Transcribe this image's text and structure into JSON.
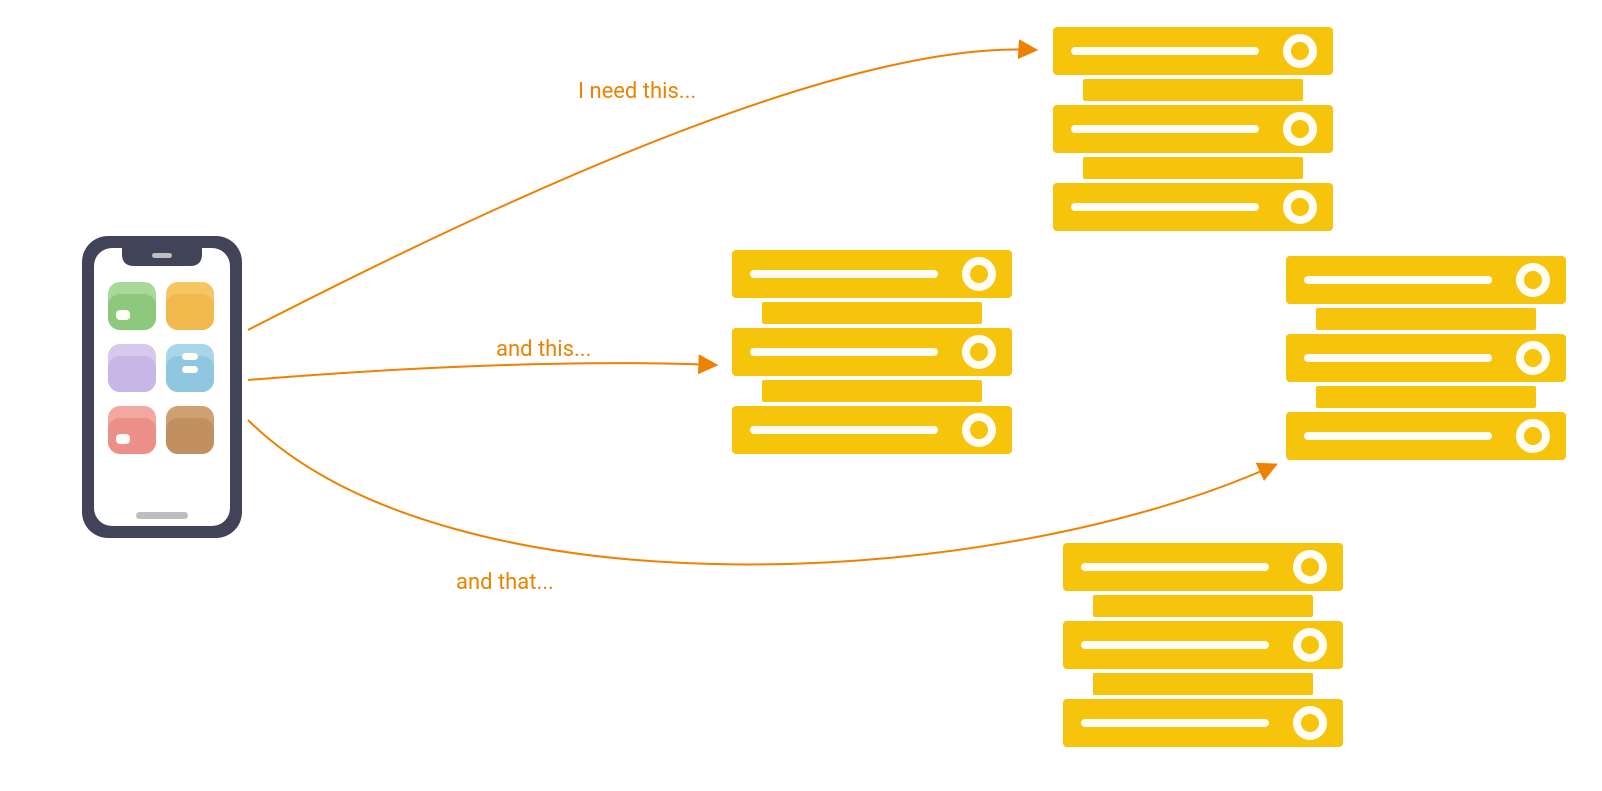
{
  "labels": {
    "arrow1": "I need this...",
    "arrow2": "and this...",
    "arrow3": "and that..."
  },
  "colors": {
    "server": "#F6C40A",
    "server_light": "#FFFDF6",
    "arrow": "#ED8200",
    "phone_frame": "#414358",
    "phone_screen": "#FFFFFF",
    "phone_speaker": "#BEBEBE",
    "phone_home": "#BEBEBE",
    "app_green_a": "#A9D89A",
    "app_green_b": "#8CC97D",
    "app_yellow_a": "#F5C662",
    "app_yellow_b": "#F1B94C",
    "app_purple_a": "#D7C9EE",
    "app_purple_b": "#C7B6E6",
    "app_blue_a": "#A9D5E8",
    "app_blue_b": "#8FC7E0",
    "app_red_a": "#F2A7A1",
    "app_red_b": "#EC8F88",
    "app_brown_a": "#CFA074",
    "app_brown_b": "#C28F5E"
  }
}
